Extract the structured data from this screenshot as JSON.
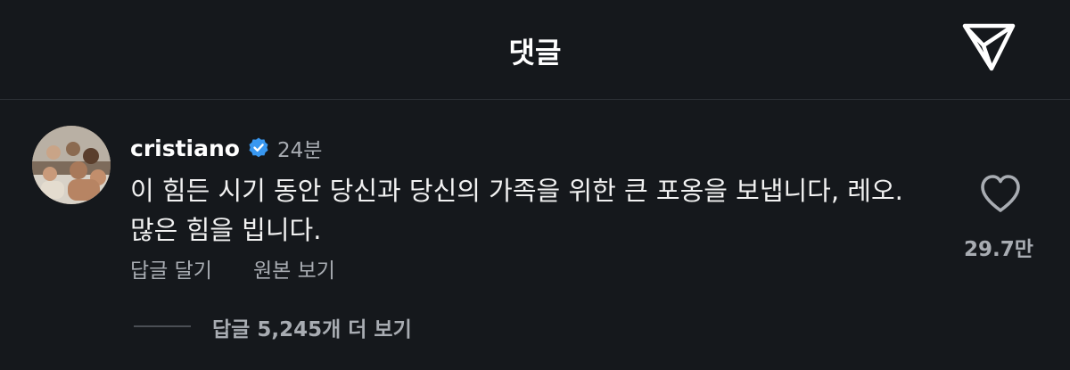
{
  "header": {
    "title": "댓글",
    "share_icon": "paper-plane-icon"
  },
  "comment": {
    "username": "cristiano",
    "verified": true,
    "verified_color": "#3897f0",
    "time": "24분",
    "text": "이 힘든 시기 동안 당신과 당신의 가족을 위한 큰 포옹을 보냅니다, 레오. 많은 힘을 빕니다.",
    "actions": {
      "reply_label": "답글 달기",
      "see_original_label": "원본 보기"
    },
    "likes": "29.7만",
    "view_replies_label": "답글 5,245개 더 보기"
  },
  "colors": {
    "background": "#15181c",
    "text_primary": "#f5f5f5",
    "text_secondary": "#a8acb2",
    "divider": "#2c3036"
  }
}
